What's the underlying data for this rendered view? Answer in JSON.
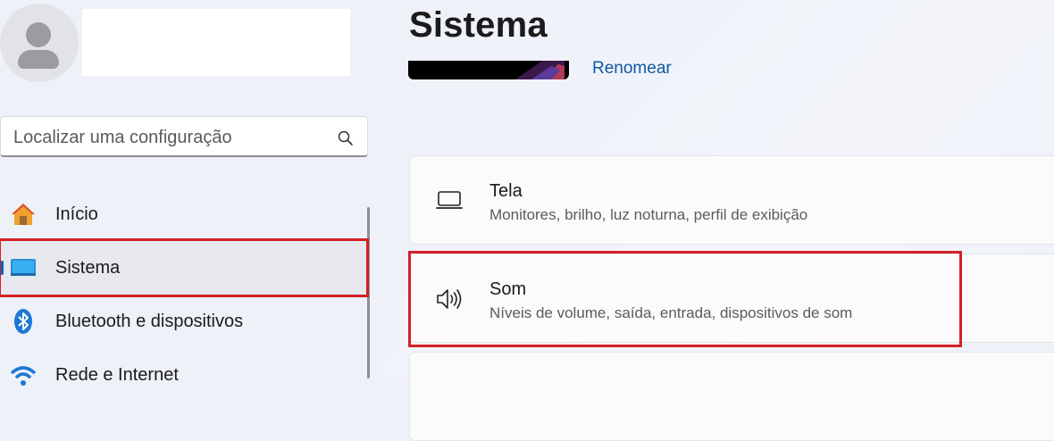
{
  "page": {
    "title": "Sistema"
  },
  "device": {
    "rename_label": "Renomear"
  },
  "search": {
    "placeholder": "Localizar uma configuração"
  },
  "sidebar": {
    "items": [
      {
        "label": "Início",
        "icon": "home-icon"
      },
      {
        "label": "Sistema",
        "icon": "system-monitor-icon",
        "selected": true
      },
      {
        "label": "Bluetooth e dispositivos",
        "icon": "bluetooth-icon"
      },
      {
        "label": "Rede e Internet",
        "icon": "wifi-icon"
      }
    ]
  },
  "cards": [
    {
      "title": "Tela",
      "subtitle": "Monitores, brilho, luz noturna, perfil de exibição",
      "icon": "display-icon"
    },
    {
      "title": "Som",
      "subtitle": "Níveis de volume, saída, entrada, dispositivos de som",
      "icon": "speaker-icon"
    }
  ],
  "colors": {
    "accent": "#0067c0",
    "highlight": "#d42027",
    "link": "#0f5aa0"
  }
}
